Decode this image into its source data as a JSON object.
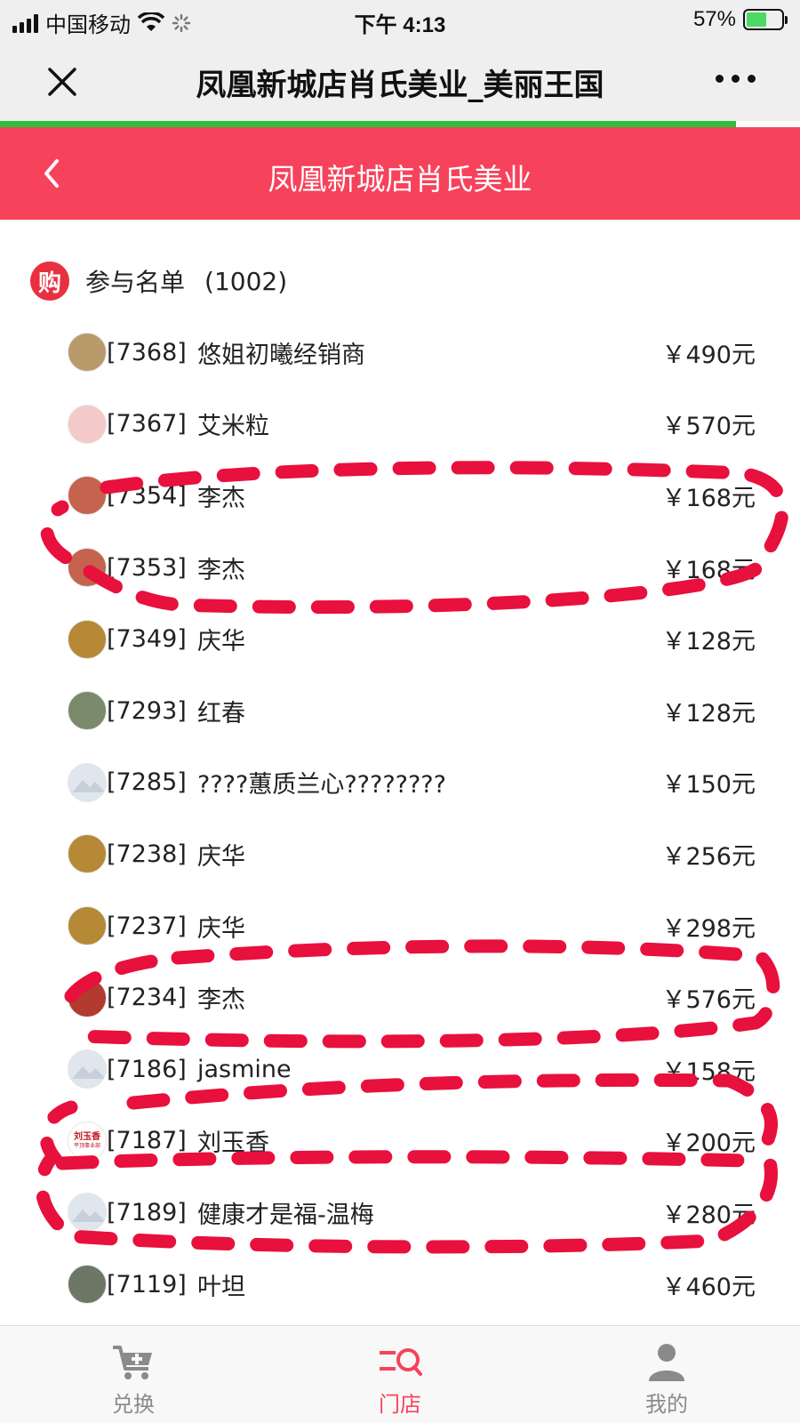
{
  "status_bar": {
    "carrier": "中国移动",
    "time": "下午 4:13",
    "battery": "57%",
    "battery_level": 0.57
  },
  "wechat_bar": {
    "title": "凤凰新城店肖氏美业_美丽王国",
    "close_icon": "close-icon",
    "more_icon": "more-dots-icon"
  },
  "header": {
    "title": "凤凰新城店肖氏美业",
    "back_icon": "chevron-left-icon"
  },
  "section": {
    "badge": "购",
    "label": "参与名单",
    "count": "(1002)"
  },
  "participants": [
    {
      "id": "[7368]",
      "name": "悠姐初曦经销商",
      "amount": "￥490元",
      "avatar_color": "#b99a6a"
    },
    {
      "id": "[7367]",
      "name": "艾米粒",
      "amount": "￥570元",
      "avatar_color": "#f3c9c9"
    },
    {
      "id": "[7354]",
      "name": "李杰",
      "amount": "￥168元",
      "avatar_color": "#c4634e"
    },
    {
      "id": "[7353]",
      "name": "李杰",
      "amount": "￥168元",
      "avatar_color": "#c4634e"
    },
    {
      "id": "[7349]",
      "name": "庆华",
      "amount": "￥128元",
      "avatar_color": "#b58936"
    },
    {
      "id": "[7293]",
      "name": "红春",
      "amount": "￥128元",
      "avatar_color": "#7a8a6a"
    },
    {
      "id": "[7285]",
      "name": "????蕙质兰心????????",
      "amount": "￥150元",
      "avatar_color": "#dfe6ee"
    },
    {
      "id": "[7238]",
      "name": "庆华",
      "amount": "￥256元",
      "avatar_color": "#b58936"
    },
    {
      "id": "[7237]",
      "name": "庆华",
      "amount": "￥298元",
      "avatar_color": "#b58936"
    },
    {
      "id": "[7234]",
      "name": "李杰",
      "amount": "￥576元",
      "avatar_color": "#b23a2e"
    },
    {
      "id": "[7186]",
      "name": "jasmine",
      "amount": "￥158元",
      "avatar_color": "#dfe6ee"
    },
    {
      "id": "[7187]",
      "name": "刘玉香",
      "amount": "￥200元",
      "avatar_color": "#ffffff"
    },
    {
      "id": "[7189]",
      "name": "健康才是福-温梅",
      "amount": "￥280元",
      "avatar_color": "#dfe6ee"
    },
    {
      "id": "[7119]",
      "name": "叶坦",
      "amount": "￥460元",
      "avatar_color": "#6d7766"
    }
  ],
  "avatar_7187_text": {
    "top": "刘玉香",
    "bottom": "平顶事业部"
  },
  "tabbar": [
    {
      "label": "兑换",
      "icon": "cart-plus-icon",
      "active": false
    },
    {
      "label": "门店",
      "icon": "store-search-icon",
      "active": true
    },
    {
      "label": "我的",
      "icon": "user-icon",
      "active": false
    }
  ],
  "colors": {
    "header_red": "#f7425b",
    "annotation_red": "#e8103c",
    "progress_green": "#2fbf3a",
    "tab_active": "#f7425b"
  }
}
